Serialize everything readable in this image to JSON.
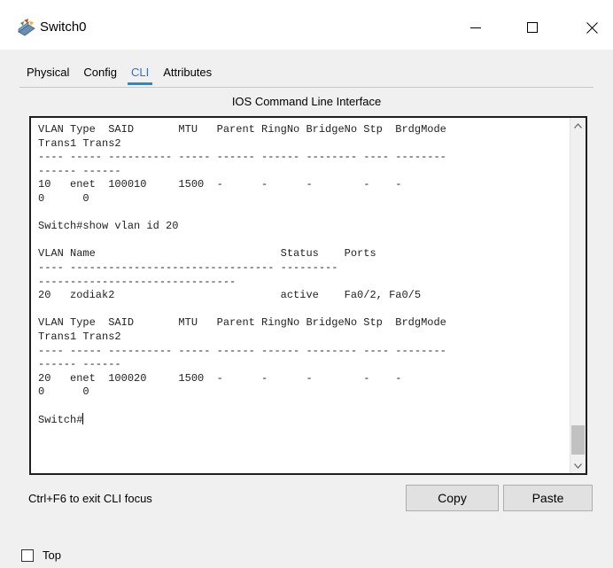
{
  "window": {
    "title": "Switch0",
    "icon": "switch-device-icon",
    "controls": [
      "minimize-icon",
      "maximize-icon",
      "close-icon"
    ]
  },
  "tabs": [
    {
      "label": "Physical",
      "active": false
    },
    {
      "label": "Config",
      "active": false
    },
    {
      "label": "CLI",
      "active": true
    },
    {
      "label": "Attributes",
      "active": false
    }
  ],
  "cli": {
    "heading": "IOS Command Line Interface",
    "output": "VLAN Type  SAID       MTU   Parent RingNo BridgeNo Stp  BrdgMode\nTrans1 Trans2\n---- ----- ---------- ----- ------ ------ -------- ---- --------\n------ ------\n10   enet  100010     1500  -      -      -        -    -\n0      0\n\nSwitch#show vlan id 20\n\nVLAN Name                             Status    Ports\n---- -------------------------------- ---------\n-------------------------------\n20   zodiak2                          active    Fa0/2, Fa0/5\n\nVLAN Type  SAID       MTU   Parent RingNo BridgeNo Stp  BrdgMode\nTrans1 Trans2\n---- ----- ---------- ----- ------ ------ -------- ---- --------\n------ ------\n20   enet  100020     1500  -      -      -        -    -\n0      0\n\n",
    "prompt": "Switch#"
  },
  "footer": {
    "focus_hint": "Ctrl+F6 to exit CLI focus",
    "copy_label": "Copy",
    "paste_label": "Paste",
    "top_label": "Top",
    "top_checked": false
  },
  "colors": {
    "active_tab_text": "#2f6fd4",
    "active_tab_underline": "#1a8fd6",
    "terminal_bg": "#ffffff",
    "window_bg": "#f0f0f0"
  }
}
